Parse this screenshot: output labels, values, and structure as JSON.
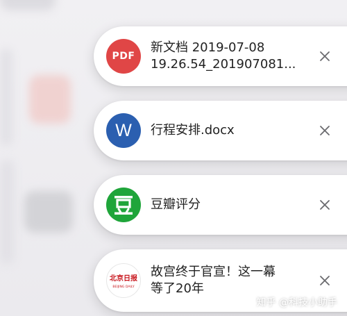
{
  "notifications": [
    {
      "app": "PDF",
      "icon": "pdf-icon",
      "icon_color": "#e04646",
      "icon_text": "PDF",
      "title_lines": [
        "新文档 2019-07-08",
        "19.26.54_201907081..."
      ]
    },
    {
      "app": "Word",
      "icon": "word-icon",
      "icon_color": "#2b5fb0",
      "icon_text": "W",
      "title_lines": [
        "行程安排.docx"
      ]
    },
    {
      "app": "Douban",
      "icon": "douban-icon",
      "icon_color": "#1fa53a",
      "icon_text": "豆",
      "title_lines": [
        "豆瓣评分"
      ]
    },
    {
      "app": "Beijing Daily",
      "icon": "beijing-daily-icon",
      "icon_color": "#ffffff",
      "icon_text": "北京日报",
      "icon_subtext": "BEIJING DAILY",
      "title_lines": [
        "故宫终于官宣！这一幕",
        "等了20年"
      ]
    }
  ],
  "close_glyph": "✕",
  "watermark": "知乎 @科技小助手"
}
